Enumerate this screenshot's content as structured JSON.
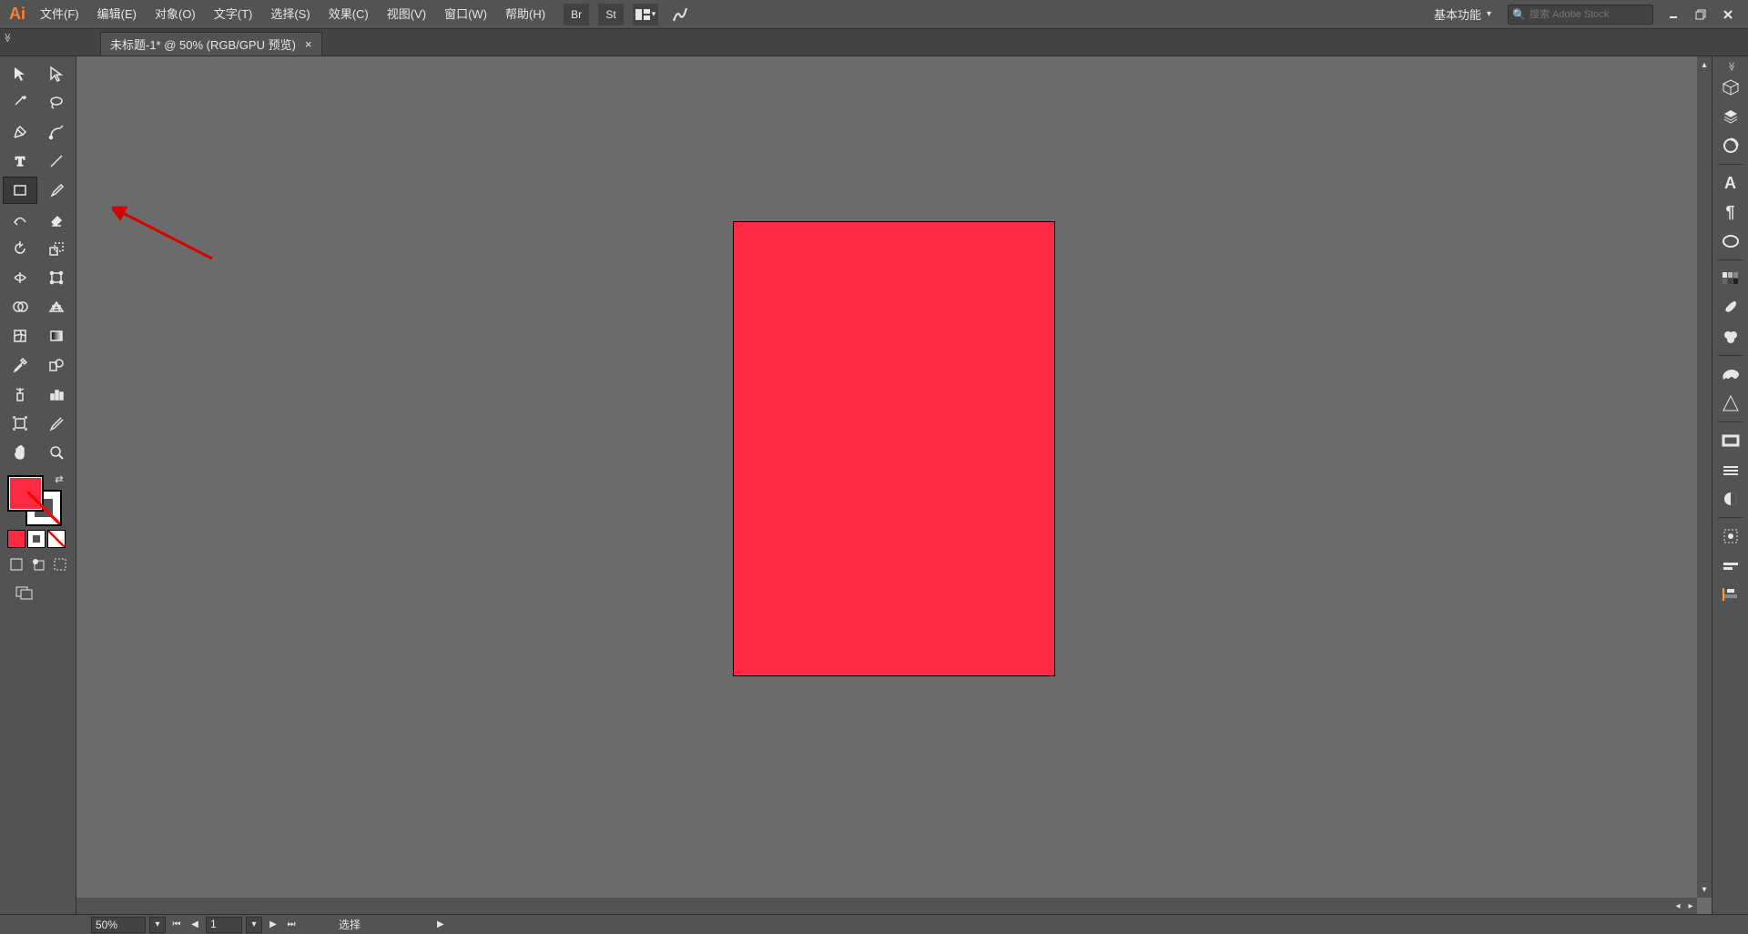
{
  "app": {
    "logo_text": "Ai"
  },
  "menu": {
    "file": "文件(F)",
    "edit": "编辑(E)",
    "object": "对象(O)",
    "type": "文字(T)",
    "select": "选择(S)",
    "effect": "效果(C)",
    "view": "视图(V)",
    "window": "窗口(W)",
    "help": "帮助(H)"
  },
  "topbar": {
    "bridge_label": "Br",
    "stock_label": "St",
    "workspace_label": "基本功能",
    "search_placeholder": "搜索 Adobe Stock"
  },
  "tab": {
    "title": "未标题-1* @ 50% (RGB/GPU 预览)"
  },
  "colors": {
    "fill": "#fc2b43",
    "stroke": "none",
    "artboard_bg": "#fc2b43"
  },
  "right_panel": {
    "type_glyph": "A",
    "paragraph_glyph": "¶"
  },
  "status": {
    "zoom": "50%",
    "artboard_page": "1",
    "tool_label": "选择"
  }
}
